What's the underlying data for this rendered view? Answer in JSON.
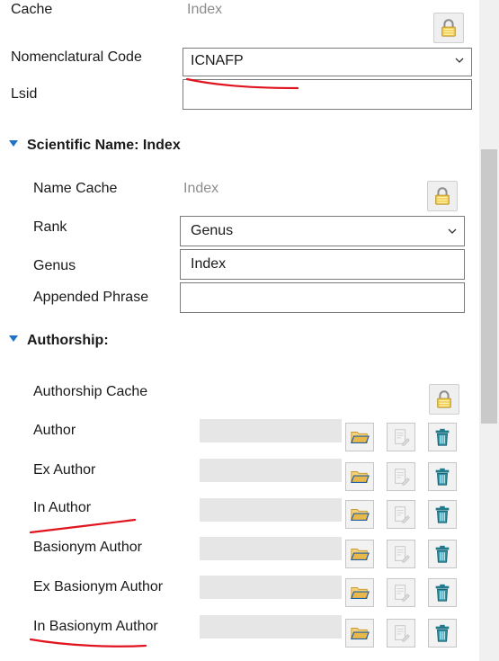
{
  "general": {
    "cache_label": "Cache",
    "cache_value": "Index",
    "nomenclatural_code_label": "Nomenclatural Code",
    "nomenclatural_code_value": "ICNAFP",
    "lsid_label": "Lsid",
    "lsid_value": ""
  },
  "scientific_name": {
    "section_title": "Scientific Name: Index",
    "name_cache_label": "Name Cache",
    "name_cache_value": "Index",
    "rank_label": "Rank",
    "rank_value": "Genus",
    "genus_label": "Genus",
    "genus_value": "Index",
    "appended_phrase_label": "Appended Phrase",
    "appended_phrase_value": ""
  },
  "authorship": {
    "section_title": "Authorship:",
    "cache_label": "Authorship Cache",
    "rows": [
      {
        "label": "Author",
        "value": ""
      },
      {
        "label": "Ex Author",
        "value": ""
      },
      {
        "label": "In Author",
        "value": ""
      },
      {
        "label": "Basionym Author",
        "value": ""
      },
      {
        "label": "Ex Basionym Author",
        "value": ""
      },
      {
        "label": "In Basionym Author",
        "value": ""
      }
    ]
  },
  "icons": {
    "lock": "lock-icon",
    "open": "folder-open-icon",
    "edit": "edit-icon",
    "delete": "trash-icon"
  },
  "colors": {
    "section_arrow": "#1e73c8",
    "annotation": "#e0141e",
    "trash": "#1f7a8c",
    "folder": "#e9b84a"
  }
}
